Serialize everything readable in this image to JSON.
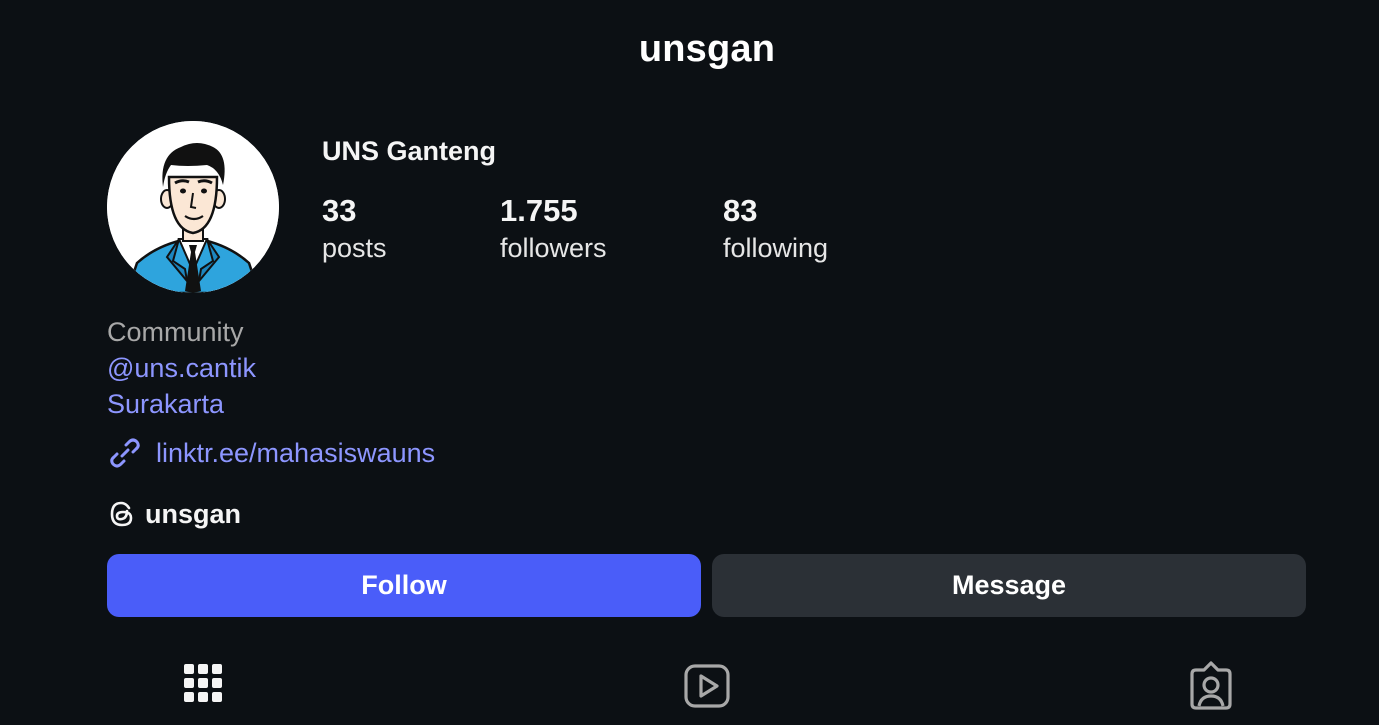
{
  "header": {
    "username": "unsgan"
  },
  "profile": {
    "display_name": "UNS Ganteng",
    "avatar_icon": "illustrated-man-in-blue-suit-avatar",
    "stats": {
      "posts_value": "33",
      "posts_label": "posts",
      "followers_value": "1.755",
      "followers_label": "followers",
      "following_value": "83",
      "following_label": "following"
    },
    "bio": {
      "category": "Community",
      "mention": "@uns.cantik",
      "location": "Surakarta"
    },
    "link": {
      "icon": "link-icon",
      "text": "linktr.ee/mahasiswauns"
    },
    "threads": {
      "icon": "threads-icon",
      "handle": "unsgan"
    }
  },
  "actions": {
    "follow_label": "Follow",
    "message_label": "Message"
  },
  "tabs": [
    {
      "name": "posts-grid",
      "icon": "grid-icon"
    },
    {
      "name": "reels",
      "icon": "reels-play-icon"
    },
    {
      "name": "tagged",
      "icon": "tagged-person-icon"
    }
  ],
  "colors": {
    "background": "#0c1014",
    "accent_link": "#8d96ff",
    "follow_button": "#4a5df9",
    "message_button": "#2b3036",
    "secondary_text": "#a8a8a8",
    "icon_gray": "#a8a8a8"
  }
}
